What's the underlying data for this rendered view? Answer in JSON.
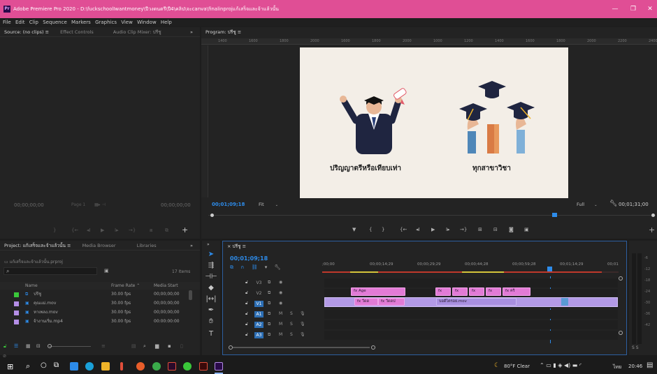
{
  "window": {
    "title": "Adobe Premiere Pro 2020 - D:\\fuckschoolIwantmoney\\ปีวงดนตรี\\ปี4\\คลิป\\จะcanva\\finalinprojแก้เสร็จและจ้าแล้วนั้น",
    "app_icon": "Pr",
    "minimize": "—",
    "restore": "❐",
    "close": "✕"
  },
  "menu": [
    "File",
    "Edit",
    "Clip",
    "Sequence",
    "Markers",
    "Graphics",
    "View",
    "Window",
    "Help"
  ],
  "source_panel": {
    "tabs": [
      "Source: (no clips)",
      "Effect Controls",
      "Audio Clip Mixer: ปรีชู"
    ],
    "tab_menu": "≡",
    "overflow": "»",
    "timecode_left": "00;00;00;00",
    "page_label": "Page 1",
    "timecode_right": "00;00;00;00"
  },
  "program_panel": {
    "tab": "Program: ปรีชู",
    "tab_menu": "≡",
    "ruler_labels": [
      "1400",
      "1600",
      "1800",
      "2000",
      "1600",
      "1800",
      "2000",
      "1000",
      "1200",
      "1400",
      "1600",
      "1800",
      "2000",
      "2200",
      "2400"
    ],
    "timecode": "00;01;09;18",
    "fit_label": "Fit",
    "quality_label": "Full",
    "duration": "00;01;31;00",
    "frame_left_caption": "ปริญญาตรีหรือเทียบเท่า",
    "frame_right_caption": "ทุกสาขาวิชา"
  },
  "project_panel": {
    "tabs": [
      "Project: แก้เสร็จและจ้าแล้วนั้น",
      "Media Browser",
      "Libraries"
    ],
    "tab_menu": "≡",
    "overflow": "»",
    "file_name": "แก้เสร็จและจ้าแล้วนั้น.prproj",
    "search_placeholder": "",
    "item_count": "17 Items",
    "columns": [
      "Name",
      "Frame Rate",
      "Media Start"
    ],
    "rows": [
      {
        "name": "ปรีชู",
        "fps": "30.00 fps",
        "start": "00;00;00;00",
        "color": "#3ac73a"
      },
      {
        "name": "คุณแม่.mov",
        "fps": "30.00 fps",
        "start": "00;00;00;00",
        "color": "#b48ee6"
      },
      {
        "name": "หาเพลง.mov",
        "fps": "30.00 fps",
        "start": "00;00;00;00",
        "color": "#b48ee6"
      },
      {
        "name": "จ้างานเริ่ม.mp4",
        "fps": "30.00 fps",
        "start": "00:00:00:00",
        "color": "#b48ee6"
      }
    ]
  },
  "timeline_panel": {
    "tab": "ปรีชู",
    "tab_menu": "≡",
    "close": "×",
    "timecode": "00;01;09;18",
    "ruler_labels": [
      ";00;00",
      "00;00;14;29",
      "00;00;29;29",
      "00;00;44;28",
      "00;00;59;28",
      "00;01;14;29",
      "00;01"
    ],
    "tracks": [
      {
        "label": "V3",
        "sync": "V3"
      },
      {
        "label": "V2",
        "sync": "V2"
      },
      {
        "label": "V1",
        "sync": "V1",
        "target": "V1"
      },
      {
        "label": "A1",
        "target": "A1",
        "m": "M",
        "s": "S"
      },
      {
        "label": "A2",
        "target": "A2",
        "m": "M",
        "s": "S"
      },
      {
        "label": "A3",
        "target": "A3",
        "m": "M",
        "s": "S"
      }
    ],
    "clips": {
      "v2_a": "fx Age",
      "v2_b": [
        "fx",
        "fx",
        "fx",
        "fx",
        "fx คริ"
      ],
      "v1_a": "fx วีดด",
      "v1_b": "fx วีดดป",
      "v1_c": "บอดีไตรอย.mov"
    }
  },
  "audio_meter": {
    "labels": [
      "-6",
      "-12",
      "-18",
      "-24",
      "-30",
      "-36",
      "-42"
    ],
    "solo": [
      "S",
      "S"
    ]
  },
  "taskbar": {
    "weather": "80°F  Clear",
    "lang": "ไทย",
    "time": "20:46"
  }
}
